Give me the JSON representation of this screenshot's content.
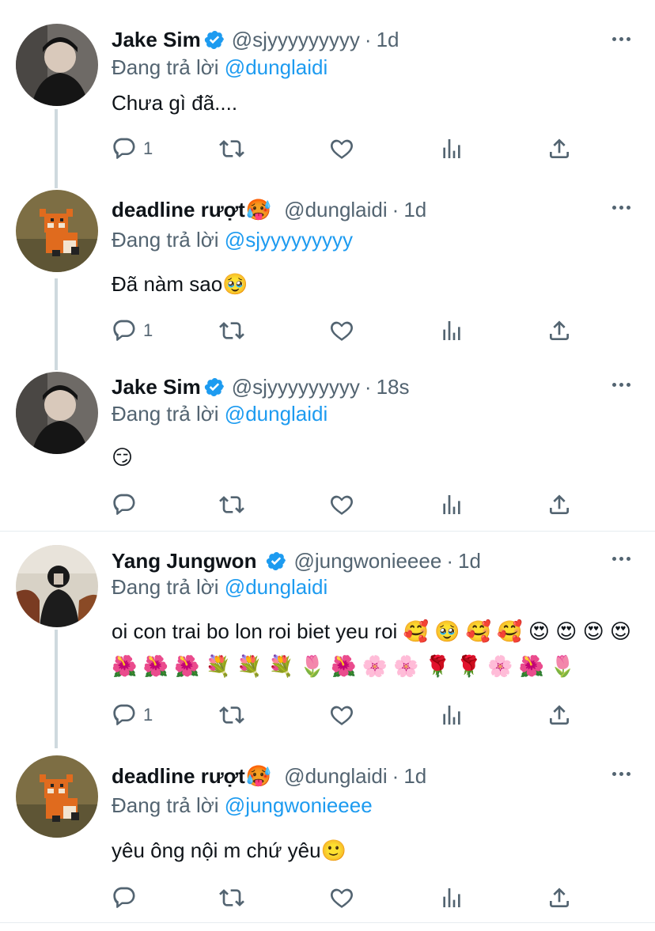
{
  "replying_prefix": "Đang trả lời",
  "colors": {
    "link": "#1d9bf0",
    "secondary": "#536471",
    "divider": "#e6ecf0",
    "verified": "#1d9bf0"
  },
  "tweets": [
    {
      "name": "Jake Sim",
      "name_emoji": "",
      "verified": true,
      "handle": "@sjyyyyyyyyy",
      "time": "1d",
      "reply_to": "@dunglaidi",
      "text": "Chưa gì đã....",
      "reply_count": "1",
      "avatar": "jake-sim-avatar"
    },
    {
      "name": "deadline rượt",
      "name_emoji": "🥵",
      "verified": false,
      "handle": "@dunglaidi",
      "time": "1d",
      "reply_to": "@sjyyyyyyyyy",
      "text": "Đã nàm sao🥹",
      "reply_count": "1",
      "avatar": "fox-avatar"
    },
    {
      "name": "Jake Sim",
      "name_emoji": "",
      "verified": true,
      "handle": "@sjyyyyyyyyy",
      "time": "18s",
      "reply_to": "@dunglaidi",
      "text": "😏",
      "reply_count": "",
      "avatar": "jake-sim-avatar"
    },
    {
      "name": "Yang Jungwon",
      "name_emoji": "",
      "verified": true,
      "handle": "@jungwonieeee",
      "time": "1d",
      "reply_to": "@dunglaidi",
      "text": "oi con trai bo lon roi biet yeu roi 🥰 🥹 🥰 🥰 😍 😍 😍 😍 🌺 🌺 🌺 💐 💐 💐 🌷 🌺 🌸 🌸 🌹 🌹 🌸 🌺 🌷",
      "reply_count": "1",
      "avatar": "jungwon-avatar"
    },
    {
      "name": "deadline rượt",
      "name_emoji": "🥵",
      "verified": false,
      "handle": "@dunglaidi",
      "time": "1d",
      "reply_to": "@jungwonieeee",
      "text": "yêu ông nội m chứ yêu🙂",
      "reply_count": "",
      "avatar": "fox-avatar"
    }
  ],
  "icons": [
    "reply-icon",
    "retweet-icon",
    "like-icon",
    "analytics-icon",
    "share-icon",
    "more-icon",
    "verified-badge-icon"
  ]
}
